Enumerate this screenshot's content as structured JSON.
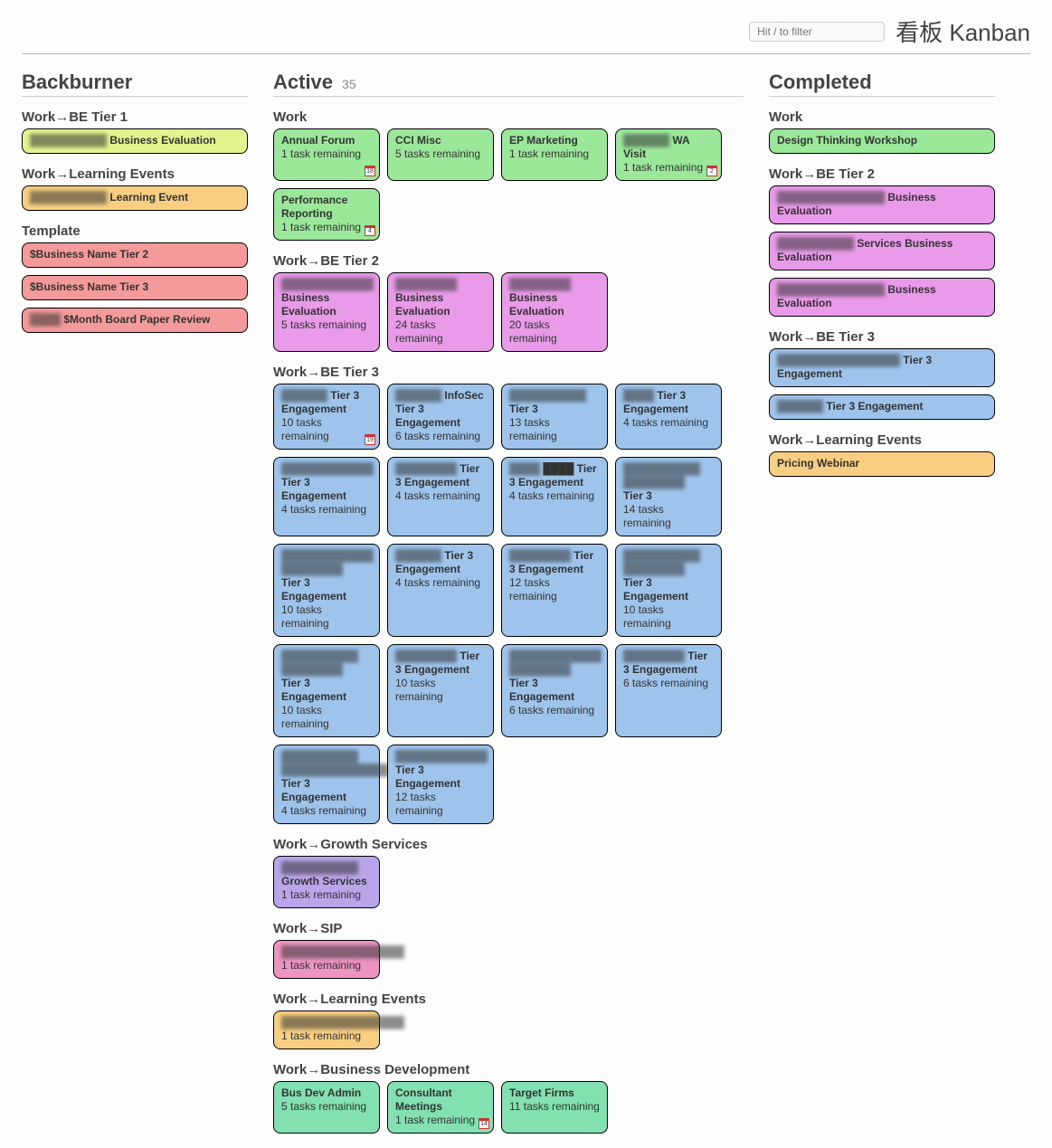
{
  "app": {
    "title": "看板 Kanban",
    "filter_placeholder": "Hit / to filter"
  },
  "columns": {
    "backburner": {
      "title": "Backburner",
      "count": ""
    },
    "active": {
      "title": "Active",
      "count": "35"
    },
    "completed": {
      "title": "Completed",
      "count": ""
    }
  },
  "colors": {
    "green": "#9be89b",
    "yellow": "#e3f48f",
    "orange": "#f8cf82",
    "red": "#f59a9a",
    "magenta": "#e99ae9",
    "blue": "#9ec4ec",
    "purple": "#b9a6ea",
    "pink": "#ee94c0",
    "teal": "#83e0b0"
  },
  "groups": {
    "backburner": [
      {
        "title": "Work→BE Tier 1",
        "color": "yellow",
        "cards": [
          {
            "redacted": "██████████",
            "title": "Business Evaluation",
            "sub": ""
          }
        ]
      },
      {
        "title": "Work→Learning Events",
        "color": "orange",
        "cards": [
          {
            "redacted": "██████████",
            "title": "Learning Event",
            "sub": ""
          }
        ]
      },
      {
        "title": "Template",
        "color": "red",
        "cards": [
          {
            "title": "$Business Name Tier 2",
            "sub": ""
          },
          {
            "title": "$Business Name Tier 3",
            "sub": ""
          },
          {
            "redacted": "████",
            "title": "$Month Board Paper Review",
            "sub": ""
          }
        ]
      }
    ],
    "active": [
      {
        "title": "Work",
        "color": "green",
        "cards": [
          {
            "title": "Annual Forum",
            "sub": "1 task remaining",
            "cal": "18"
          },
          {
            "title": "CCI Misc",
            "sub": "5 tasks remaining"
          },
          {
            "title": "EP Marketing",
            "sub": "1 task remaining"
          },
          {
            "redacted": "██████",
            "title": "WA Visit",
            "sub": "1 task remaining",
            "cal": "2"
          },
          {
            "title": "Performance Reporting",
            "sub": "1 task remaining",
            "cal": "4"
          }
        ]
      },
      {
        "title": "Work→BE Tier 2",
        "color": "magenta",
        "cards": [
          {
            "redacted": "████████████",
            "title": "Business Evaluation",
            "sub": "5 tasks remaining"
          },
          {
            "redacted": "████████",
            "title": "Business Evaluation",
            "sub": "24 tasks remaining"
          },
          {
            "redacted": "████████",
            "title": "Business Evaluation",
            "sub": "20 tasks remaining"
          }
        ]
      },
      {
        "title": "Work→BE Tier 3",
        "color": "blue",
        "cards": [
          {
            "redacted": "██████",
            "title": "Tier 3 Engagement",
            "sub": "10 tasks remaining",
            "cal": "19"
          },
          {
            "redacted": "██████",
            "title": "InfoSec Tier 3 Engagement",
            "sub": "6 tasks remaining"
          },
          {
            "redacted": "██████████",
            "title": "Tier 3",
            "sub": "13 tasks remaining"
          },
          {
            "redacted": "████",
            "title": "Tier 3 Engagement",
            "sub": "4 tasks remaining"
          },
          {
            "redacted": "████████████",
            "title": "Tier 3 Engagement",
            "sub": "4 tasks remaining"
          },
          {
            "redacted": "████████",
            "title": "Tier 3 Engagement",
            "sub": "4 tasks remaining"
          },
          {
            "redacted": "████",
            "title": "████ Tier 3 Engagement",
            "sub": "4 tasks remaining"
          },
          {
            "redacted": "██████████ ████████",
            "title": "Tier 3",
            "sub": "14 tasks remaining"
          },
          {
            "redacted": "████████████ ████████",
            "title": "Tier 3 Engagement",
            "sub": "10 tasks remaining"
          },
          {
            "redacted": "██████",
            "title": "Tier 3 Engagement",
            "sub": "4 tasks remaining"
          },
          {
            "redacted": "████████",
            "title": "Tier 3 Engagement",
            "sub": "12 tasks remaining"
          },
          {
            "redacted": "██████████ ████████",
            "title": "Tier 3 Engagement",
            "sub": "10 tasks remaining"
          },
          {
            "redacted": "██████████ ████████",
            "title": "Tier 3 Engagement",
            "sub": "10 tasks remaining"
          },
          {
            "redacted": "████████",
            "title": "Tier 3 Engagement",
            "sub": "10 tasks remaining"
          },
          {
            "redacted": "████████████ ████████",
            "title": "Tier 3 Engagement",
            "sub": "6 tasks remaining"
          },
          {
            "redacted": "████████",
            "title": "Tier 3 Engagement",
            "sub": "6 tasks remaining"
          },
          {
            "redacted": "██████████ ██████████████",
            "title": "Tier 3 Engagement",
            "sub": "4 tasks remaining"
          },
          {
            "redacted": "████████████",
            "title": "Tier 3 Engagement",
            "sub": "12 tasks remaining"
          }
        ]
      },
      {
        "title": "Work→Growth Services",
        "color": "purple",
        "cards": [
          {
            "redacted": "██████████",
            "title": "Growth Services",
            "sub": "1 task remaining"
          }
        ]
      },
      {
        "title": "Work→SIP",
        "color": "pink",
        "cards": [
          {
            "redacted": "████████████████",
            "title": "",
            "sub": "1 task remaining"
          }
        ]
      },
      {
        "title": "Work→Learning Events",
        "color": "orange",
        "cards": [
          {
            "redacted": "████████████████",
            "title": "",
            "sub": "1 task remaining"
          }
        ]
      },
      {
        "title": "Work→Business Development",
        "color": "teal",
        "cards": [
          {
            "title": "Bus Dev Admin",
            "sub": "5 tasks remaining"
          },
          {
            "title": "Consultant Meetings",
            "sub": "1 task remaining",
            "cal": "14"
          },
          {
            "title": "Target Firms",
            "sub": "11 tasks remaining"
          }
        ]
      }
    ],
    "completed": [
      {
        "title": "Work",
        "color": "green",
        "cards": [
          {
            "title": "Design Thinking Workshop",
            "sub": ""
          }
        ]
      },
      {
        "title": "Work→BE Tier 2",
        "color": "magenta",
        "cards": [
          {
            "redacted": "██████████████",
            "title": "Business Evaluation",
            "sub": ""
          },
          {
            "redacted": "██████████",
            "title": "Services Business Evaluation",
            "sub": ""
          },
          {
            "redacted": "██████████████",
            "title": "Business Evaluation",
            "sub": ""
          }
        ]
      },
      {
        "title": "Work→BE Tier 3",
        "color": "blue",
        "cards": [
          {
            "redacted": "████████████████",
            "title": "Tier 3 Engagement",
            "sub": ""
          },
          {
            "redacted": "██████",
            "title": "Tier 3 Engagement",
            "sub": ""
          }
        ]
      },
      {
        "title": "Work→Learning Events",
        "color": "orange",
        "cards": [
          {
            "title": "Pricing Webinar",
            "sub": ""
          }
        ]
      }
    ]
  }
}
